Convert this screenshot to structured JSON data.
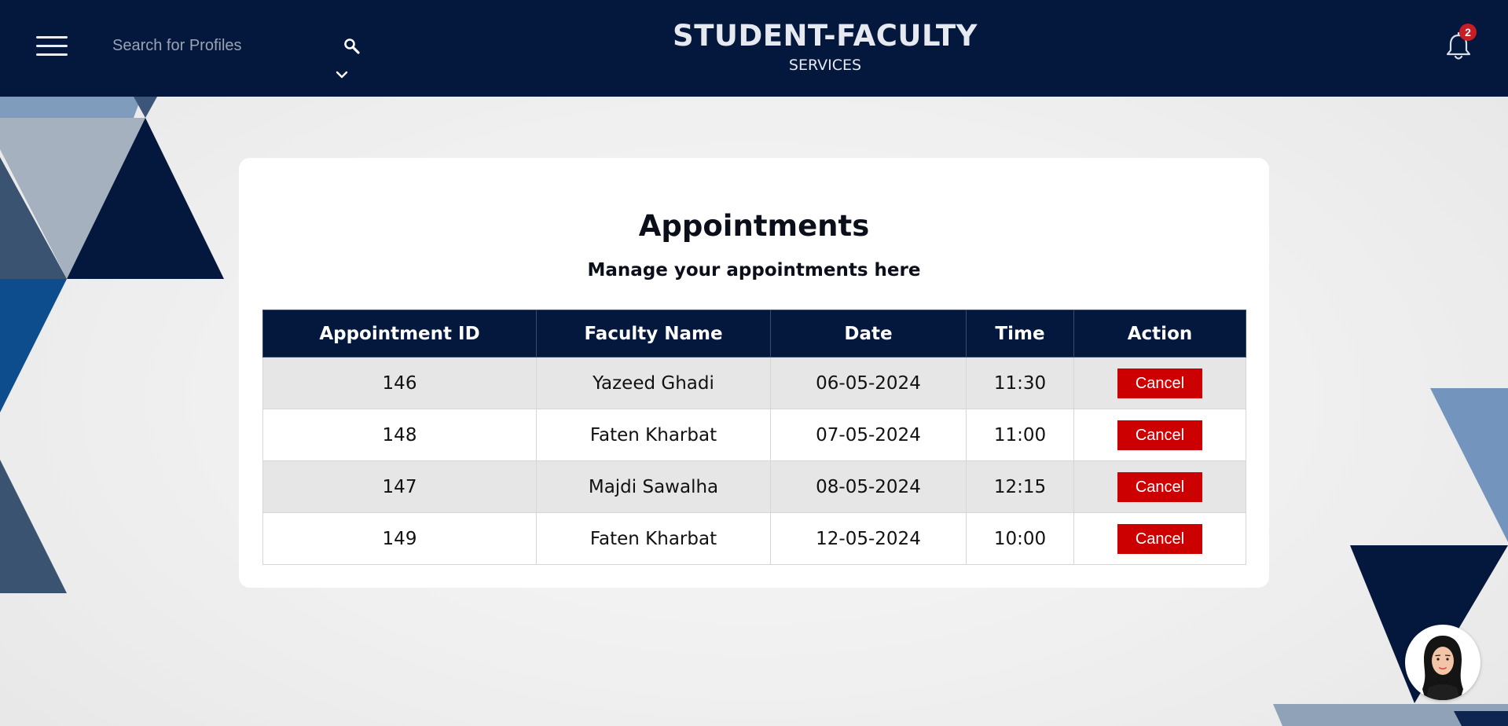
{
  "header": {
    "search_placeholder": "Search for Profiles",
    "brand_title": "STUDENT-FACULTY",
    "brand_subtitle": "SERVICES",
    "notification_count": "2",
    "icons": {
      "menu": "hamburger-menu-icon",
      "search": "search-icon",
      "expand": "chevron-down-icon",
      "notifications": "bell-icon"
    }
  },
  "main": {
    "title": "Appointments",
    "subtitle": "Manage your appointments here",
    "table": {
      "columns": [
        "Appointment ID",
        "Faculty Name",
        "Date",
        "Time",
        "Action"
      ],
      "rows": [
        {
          "id": "146",
          "faculty": "Yazeed Ghadi",
          "date": "06-05-2024",
          "time": "11:30",
          "action": "Cancel"
        },
        {
          "id": "148",
          "faculty": "Faten Kharbat",
          "date": "07-05-2024",
          "time": "11:00",
          "action": "Cancel"
        },
        {
          "id": "147",
          "faculty": "Majdi Sawalha",
          "date": "08-05-2024",
          "time": "12:15",
          "action": "Cancel"
        },
        {
          "id": "149",
          "faculty": "Faten Kharbat",
          "date": "12-05-2024",
          "time": "10:00",
          "action": "Cancel"
        }
      ]
    }
  },
  "colors": {
    "navy": "#04173d",
    "cancel_red": "#cc0000",
    "badge_red": "#c81d25",
    "row_alt": "#e6e6e6"
  }
}
